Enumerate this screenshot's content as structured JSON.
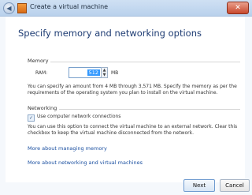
{
  "window": {
    "title": "Create a virtual machine",
    "close_label": "✕",
    "back_label": "◀"
  },
  "page": {
    "heading": "Specify memory and networking options"
  },
  "memory": {
    "group_label": "Memory",
    "ram_label": "RAM:",
    "ram_value": "512",
    "ram_unit": "MB",
    "description": "You can specify an amount from 4 MB through 3,571 MB. Specify the memory as per the requirements of the operating system you plan to install on the virtual machine."
  },
  "networking": {
    "group_label": "Networking",
    "checkbox_label": "Use computer network connections",
    "checked": true,
    "description": "You can use this option to connect the virtual machine to an external network. Clear this checkbox to keep the virtual machine disconnected from the network."
  },
  "links": {
    "memory": "More about managing memory",
    "networking": "More about networking and virtual machines"
  },
  "buttons": {
    "next": "Next",
    "cancel": "Cancel"
  }
}
